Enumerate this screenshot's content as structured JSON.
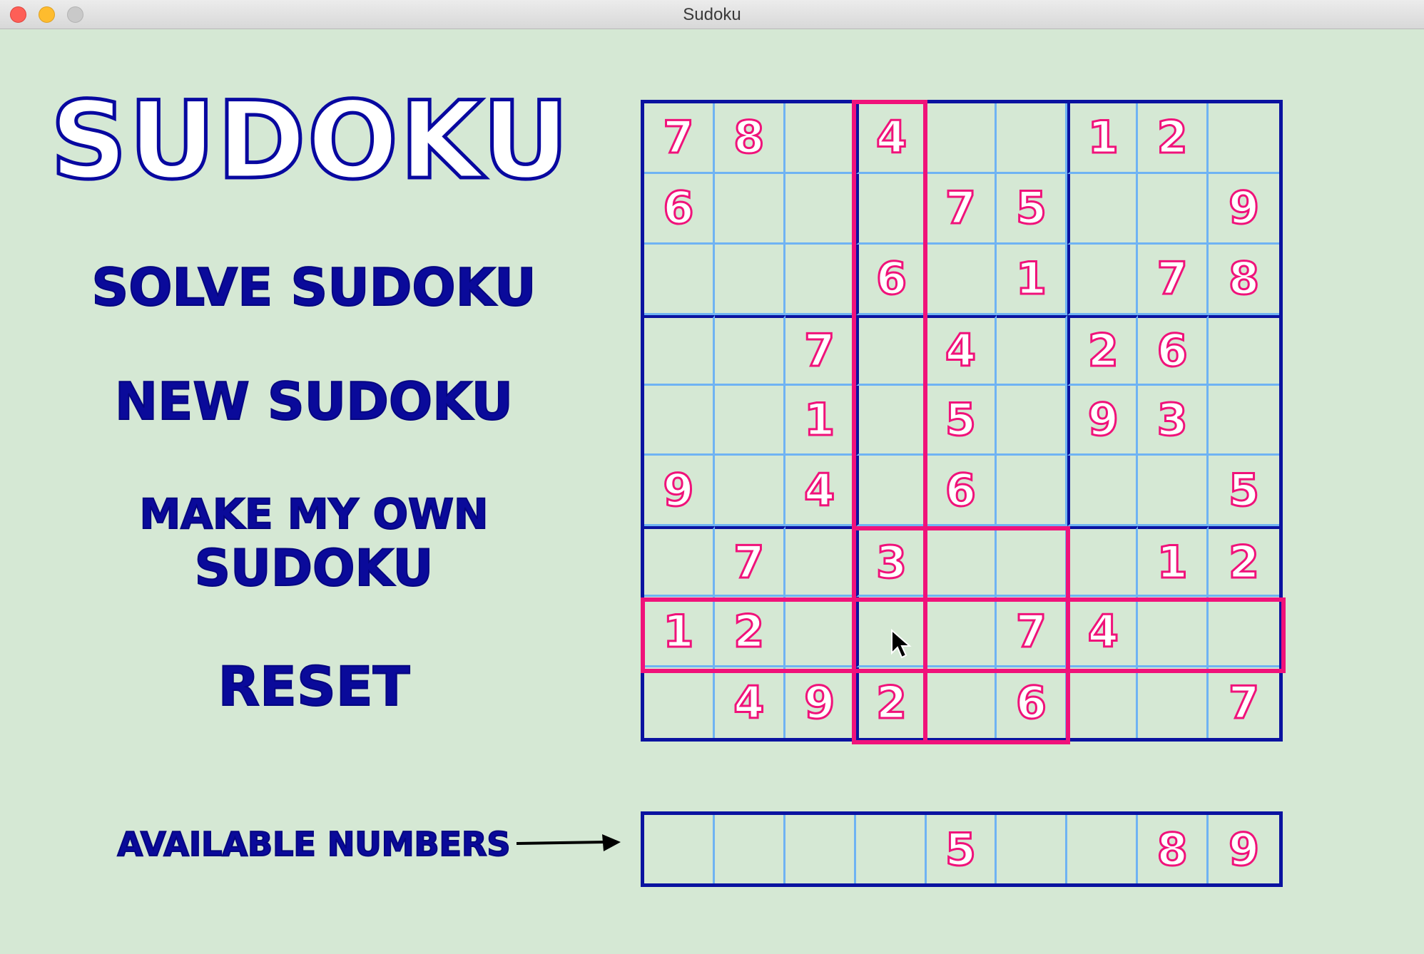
{
  "window": {
    "title": "Sudoku"
  },
  "logo": "SUDOKU",
  "menu": {
    "solve": "SOLVE SUDOKU",
    "new": "NEW SUDOKU",
    "make_line1": "MAKE MY OWN",
    "make_line2": "SUDOKU",
    "reset": "RESET"
  },
  "available_label": "AVAILABLE NUMBERS",
  "board": [
    [
      "7",
      "8",
      "",
      "4",
      "",
      "",
      "1",
      "2",
      ""
    ],
    [
      "6",
      "",
      "",
      "",
      "7",
      "5",
      "",
      "",
      "9"
    ],
    [
      "",
      "",
      "",
      "6",
      "",
      "1",
      "",
      "7",
      "8"
    ],
    [
      "",
      "",
      "7",
      "",
      "4",
      "",
      "2",
      "6",
      ""
    ],
    [
      "",
      "",
      "1",
      "",
      "5",
      "",
      "9",
      "3",
      ""
    ],
    [
      "9",
      "",
      "4",
      "",
      "6",
      "",
      "",
      "",
      "5"
    ],
    [
      "",
      "7",
      "",
      "3",
      "",
      "",
      "",
      "1",
      "2"
    ],
    [
      "1",
      "2",
      "",
      "",
      "",
      "7",
      "4",
      "",
      ""
    ],
    [
      "",
      "4",
      "9",
      "2",
      "",
      "6",
      "",
      "",
      "7"
    ]
  ],
  "selected_cell": {
    "row": 7,
    "col": 3
  },
  "available_numbers": [
    "",
    "",
    "",
    "",
    "5",
    "",
    "",
    "8",
    "9"
  ],
  "colors": {
    "background": "#d5e8d4",
    "grid_major": "#0a12a0",
    "grid_minor": "#6fb3f3",
    "digit": "#f0127a",
    "highlight": "#f0127a",
    "menu_text": "#0a0a9a"
  }
}
